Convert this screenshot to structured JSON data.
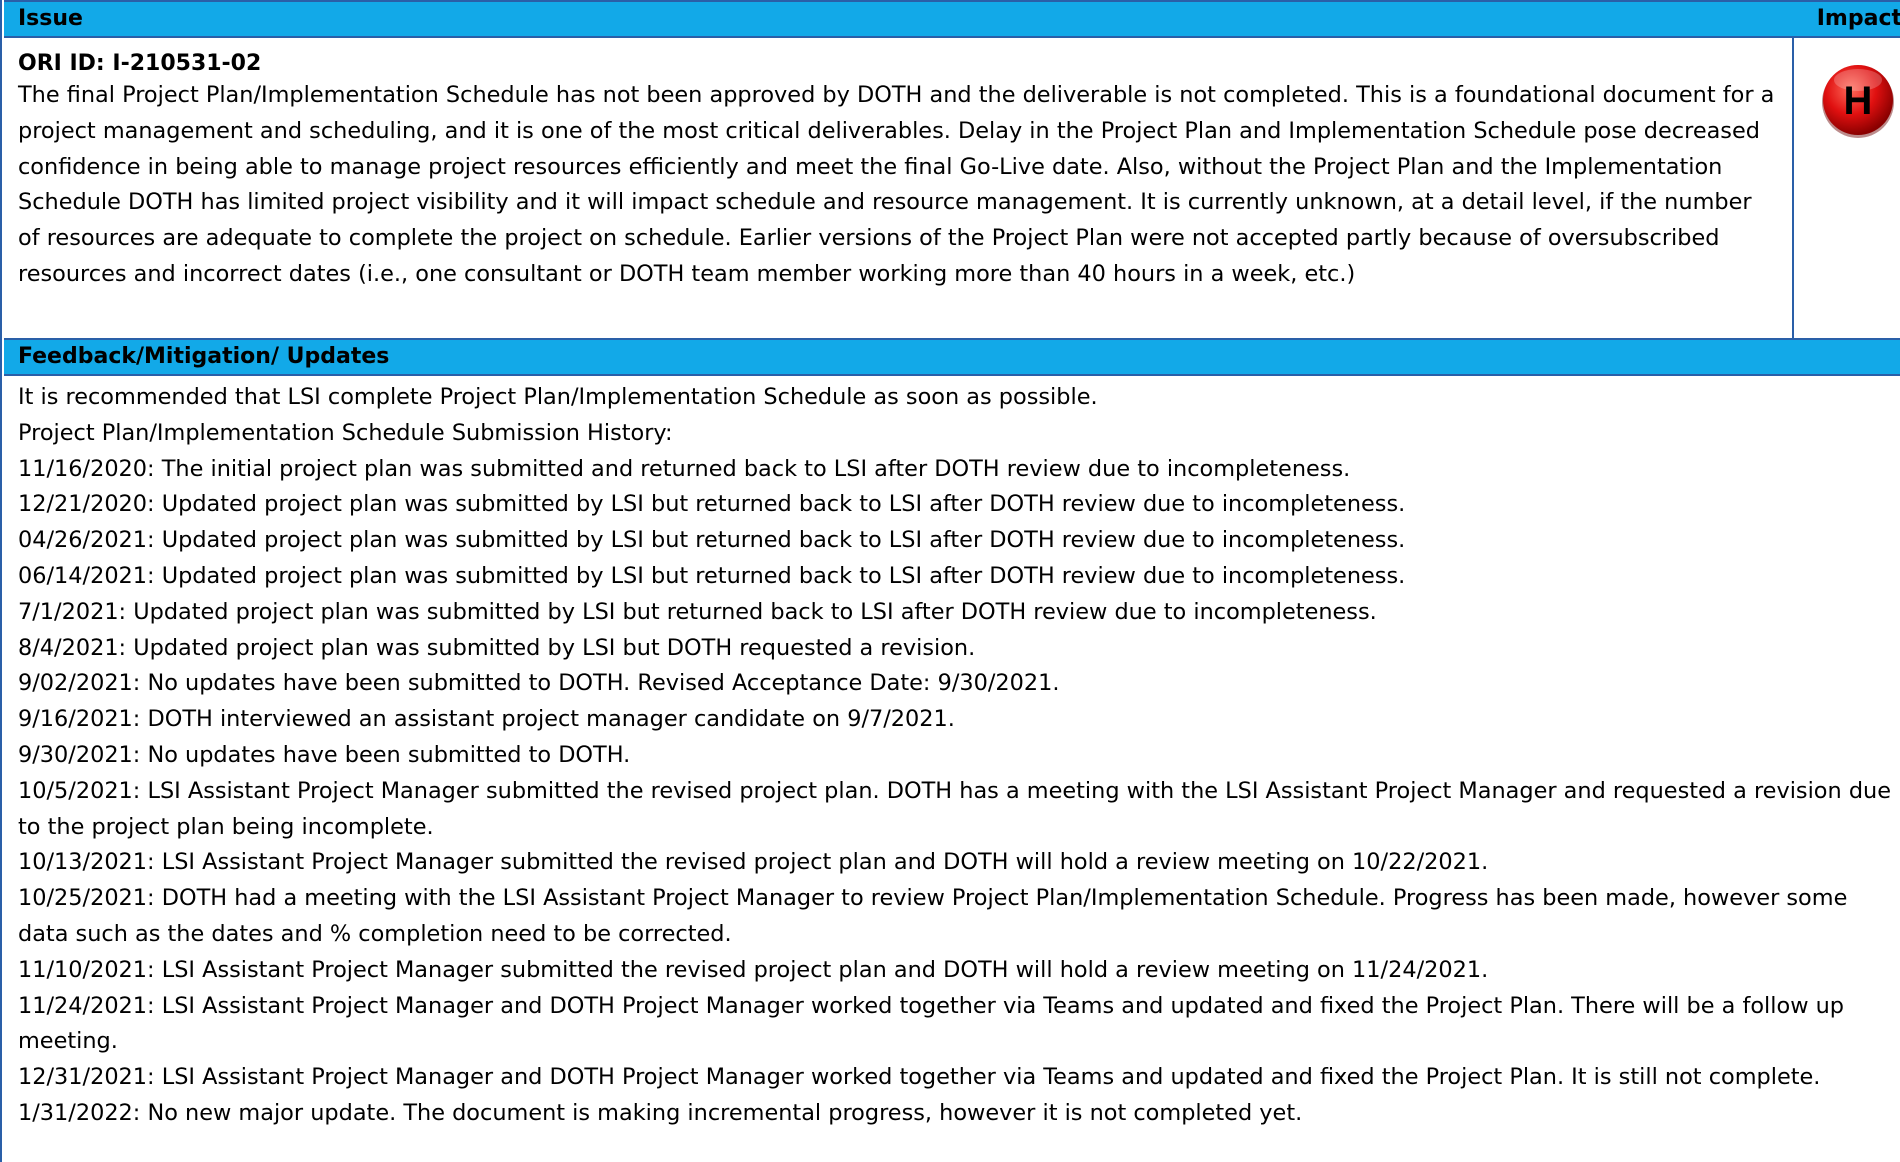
{
  "header": {
    "issue_label": "Issue",
    "impact_label": "Impact"
  },
  "issue": {
    "id_text": "ORI ID: I-210531-02",
    "description": "The final Project Plan/Implementation Schedule has not been approved by DOTH and the deliverable is not completed. This is a foundational document for a project management and scheduling, and it is one of the most critical deliverables. Delay in the Project Plan and Implementation Schedule pose decreased confidence in being able to manage project resources efficiently and meet the final Go-Live date. Also, without the Project Plan and the Implementation Schedule DOTH has limited project visibility and it will impact schedule and resource management. It is currently unknown, at a detail level, if the number of resources are adequate to complete the project on schedule. Earlier versions of the Project Plan were not accepted partly because of oversubscribed resources and incorrect dates (i.e., one consultant or DOTH team member working more than 40 hours in a week, etc.)"
  },
  "impact": {
    "letter": "H",
    "badge_color": "#e01010"
  },
  "mitigation": {
    "header_label": "Feedback/Mitigation/ Updates",
    "lines": [
      "It is recommended that LSI complete Project Plan/Implementation Schedule as soon as possible.",
      "Project Plan/Implementation Schedule Submission History:",
      "11/16/2020: The initial project plan was submitted and returned back to LSI after DOTH review due to incompleteness.",
      "12/21/2020: Updated project plan was submitted by LSI but returned back to LSI after DOTH review due to incompleteness.",
      "04/26/2021: Updated project plan was submitted by LSI but returned back to LSI after DOTH review due to incompleteness.",
      "06/14/2021: Updated project plan was submitted by LSI but returned back to LSI after DOTH review due to incompleteness.",
      "7/1/2021: Updated project plan was submitted by LSI but returned back to LSI after DOTH review due to incompleteness.",
      "8/4/2021: Updated project plan was submitted by LSI but DOTH requested a revision.",
      "9/02/2021: No updates have been submitted to DOTH. Revised Acceptance Date: 9/30/2021.",
      "9/16/2021: DOTH interviewed an assistant project manager candidate on 9/7/2021.",
      "9/30/2021: No updates have been submitted to DOTH.",
      "10/5/2021: LSI Assistant Project Manager submitted the revised project plan. DOTH has a meeting with the LSI Assistant Project Manager and requested a revision due to the project plan being incomplete.",
      "10/13/2021: LSI Assistant Project Manager submitted the revised project plan and DOTH will hold a review meeting on 10/22/2021.",
      "10/25/2021: DOTH had a meeting with the LSI Assistant Project Manager to review Project Plan/Implementation Schedule. Progress has been made, however some data such as the dates and % completion need to be corrected.",
      "11/10/2021: LSI Assistant Project Manager submitted the revised project plan and DOTH will hold a review meeting on 11/24/2021.",
      "11/24/2021: LSI Assistant Project Manager and DOTH Project Manager worked together via Teams and updated and fixed the Project Plan. There will be a follow up meeting.",
      "12/31/2021: LSI Assistant Project Manager and DOTH Project Manager worked together via Teams and updated and fixed the Project Plan. It is still not complete.",
      "1/31/2022: No new major update.  The document is making incremental progress, however it is not completed yet."
    ]
  }
}
